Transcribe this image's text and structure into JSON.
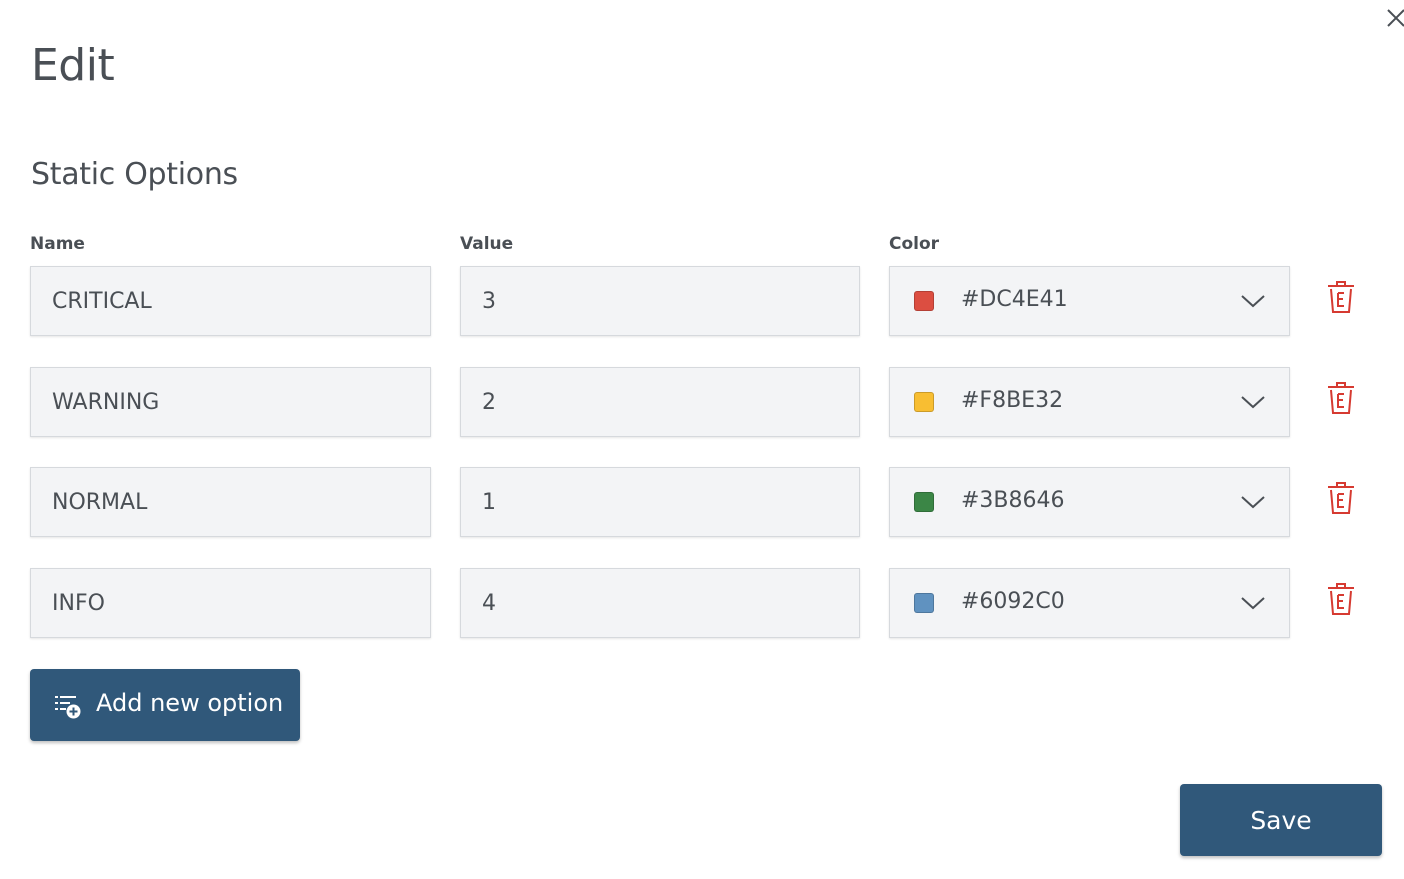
{
  "dialog": {
    "title": "Edit",
    "subtitle": "Static Options",
    "close_icon": "close-icon"
  },
  "columns": {
    "name": "Name",
    "value": "Value",
    "color": "Color"
  },
  "options": [
    {
      "name": "CRITICAL",
      "value": "3",
      "color": "#DC4E41"
    },
    {
      "name": "WARNING",
      "value": "2",
      "color": "#F8BE32"
    },
    {
      "name": "NORMAL",
      "value": "1",
      "color": "#3B8646"
    },
    {
      "name": "INFO",
      "value": "4",
      "color": "#6092C0"
    }
  ],
  "actions": {
    "add_label": "Add new option",
    "add_icon": "add-list-icon",
    "save_label": "Save",
    "delete_icon": "trash-icon"
  },
  "colors": {
    "primary": "#30587A",
    "delete": "#D63A31",
    "text": "#4A4F55",
    "field_bg": "#F3F4F6"
  }
}
